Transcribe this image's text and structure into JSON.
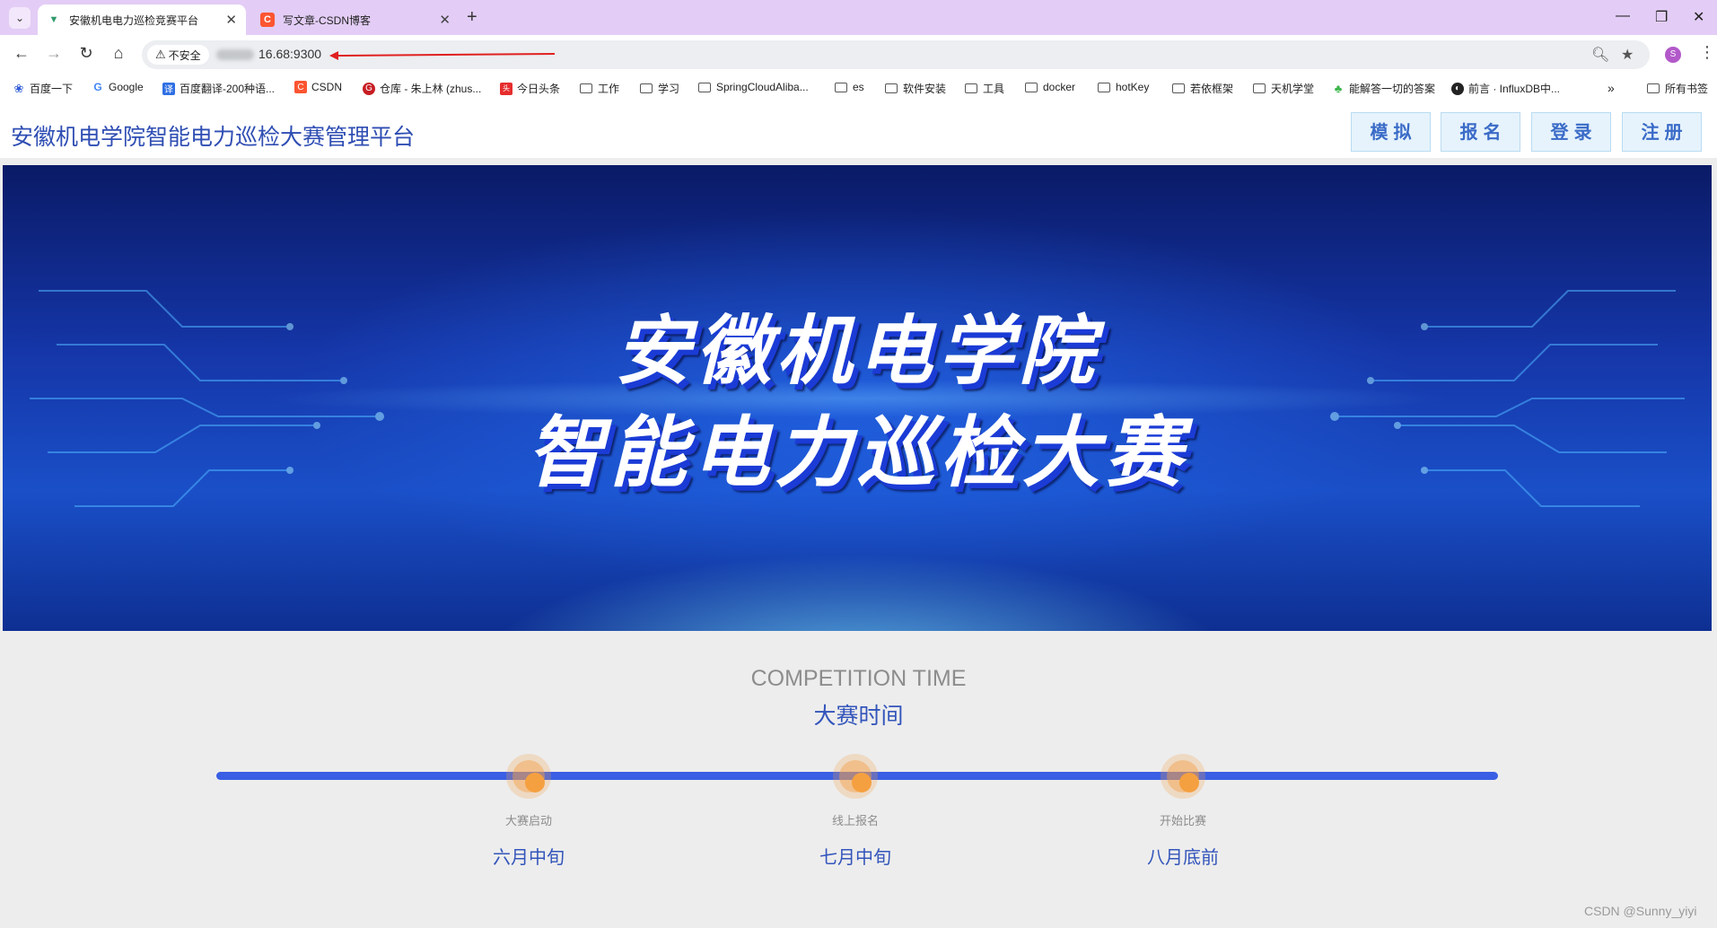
{
  "browser": {
    "tabs": [
      {
        "title": "安徽机电电力巡检竞赛平台",
        "favicon": "vue-icon",
        "active": true
      },
      {
        "title": "写文章-CSDN博客",
        "favicon": "csdn-icon",
        "active": false
      }
    ],
    "security_label": "不安全",
    "url": "16.68:9300",
    "bookmarks": [
      {
        "label": "百度一下",
        "icon": "baidu-icon"
      },
      {
        "label": "Google",
        "icon": "google-icon"
      },
      {
        "label": "百度翻译-200种语...",
        "icon": "translate-icon"
      },
      {
        "label": "CSDN",
        "icon": "csdn-icon"
      },
      {
        "label": "仓库 - 朱上林 (zhus...",
        "icon": "gitee-icon"
      },
      {
        "label": "今日头条",
        "icon": "toutiao-icon"
      },
      {
        "label": "工作",
        "icon": "folder-icon"
      },
      {
        "label": "学习",
        "icon": "folder-icon"
      },
      {
        "label": "SpringCloudAliba...",
        "icon": "folder-icon"
      },
      {
        "label": "es",
        "icon": "folder-icon"
      },
      {
        "label": "软件安装",
        "icon": "folder-icon"
      },
      {
        "label": "工具",
        "icon": "folder-icon"
      },
      {
        "label": "docker",
        "icon": "folder-icon"
      },
      {
        "label": "hotKey",
        "icon": "folder-icon"
      },
      {
        "label": "若依框架",
        "icon": "folder-icon"
      },
      {
        "label": "天机学堂",
        "icon": "folder-icon"
      },
      {
        "label": "能解答一切的答案",
        "icon": "leaf-icon"
      },
      {
        "label": "前言 · InfluxDB中...",
        "icon": "globe-icon"
      }
    ],
    "all_bookmarks_label": "所有书签",
    "avatar_letter": "S"
  },
  "header": {
    "title": "安徽机电学院智能电力巡检大赛管理平台",
    "buttons": [
      "模拟",
      "报名",
      "登录",
      "注册"
    ]
  },
  "banner": {
    "line1": "安徽机电学院",
    "line2": "智能电力巡检大赛"
  },
  "timeline": {
    "title_en": "COMPETITION TIME",
    "title_cn": "大赛时间",
    "milestones": [
      {
        "label": "大赛启动",
        "date": "六月中旬"
      },
      {
        "label": "线上报名",
        "date": "七月中旬"
      },
      {
        "label": "开始比赛",
        "date": "八月底前"
      }
    ]
  },
  "watermark": "CSDN @Sunny_yiyi",
  "colors": {
    "tabbar": "#e3cdf6",
    "title_blue": "#2f4eb3",
    "timeline_bar": "#3a5fe4",
    "milestone_dot": "#f5a040",
    "button_bg": "#e6f3fc"
  }
}
